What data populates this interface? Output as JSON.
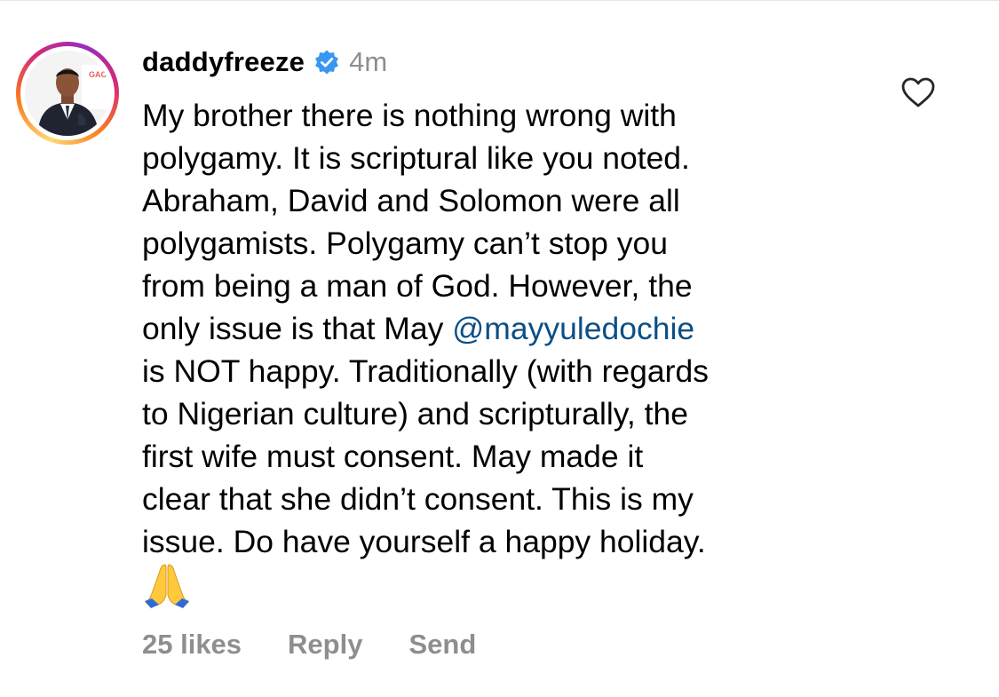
{
  "comment": {
    "username": "daddyfreeze",
    "verified": true,
    "timestamp": "4m",
    "avatar": {
      "icon": "profile-photo",
      "ring_colors": [
        "#feda75",
        "#fa7e1e",
        "#d62976",
        "#962fbf"
      ]
    },
    "text_lines": {
      "l1": "My brother there is nothing wrong with",
      "l2": "polygamy. It is scriptural like you noted.",
      "l3": "Abraham, David and Solomon were all",
      "l4": "polygamists. Polygamy can’t stop you",
      "l5": "from being a man of God. However, the",
      "l6a": "only issue is that May ",
      "l6_mention": "@mayyuledochie",
      "l7": "is NOT happy. Traditionally (with regards",
      "l8": "to Nigerian culture) and scripturally, the",
      "l9": "first wife must consent. May made it",
      "l10": "clear that she didn’t consent. This is my",
      "l11": "issue. Do have yourself a happy holiday."
    },
    "emoji": "folded-hands-emoji",
    "actions": {
      "likes": "25 likes",
      "reply": "Reply",
      "send": "Send"
    },
    "like_icon": "heart-outline-icon",
    "colors": {
      "mention": "#0b4f86",
      "secondary_text": "#8e8e8e",
      "verified_badge": "#3897f0"
    }
  }
}
